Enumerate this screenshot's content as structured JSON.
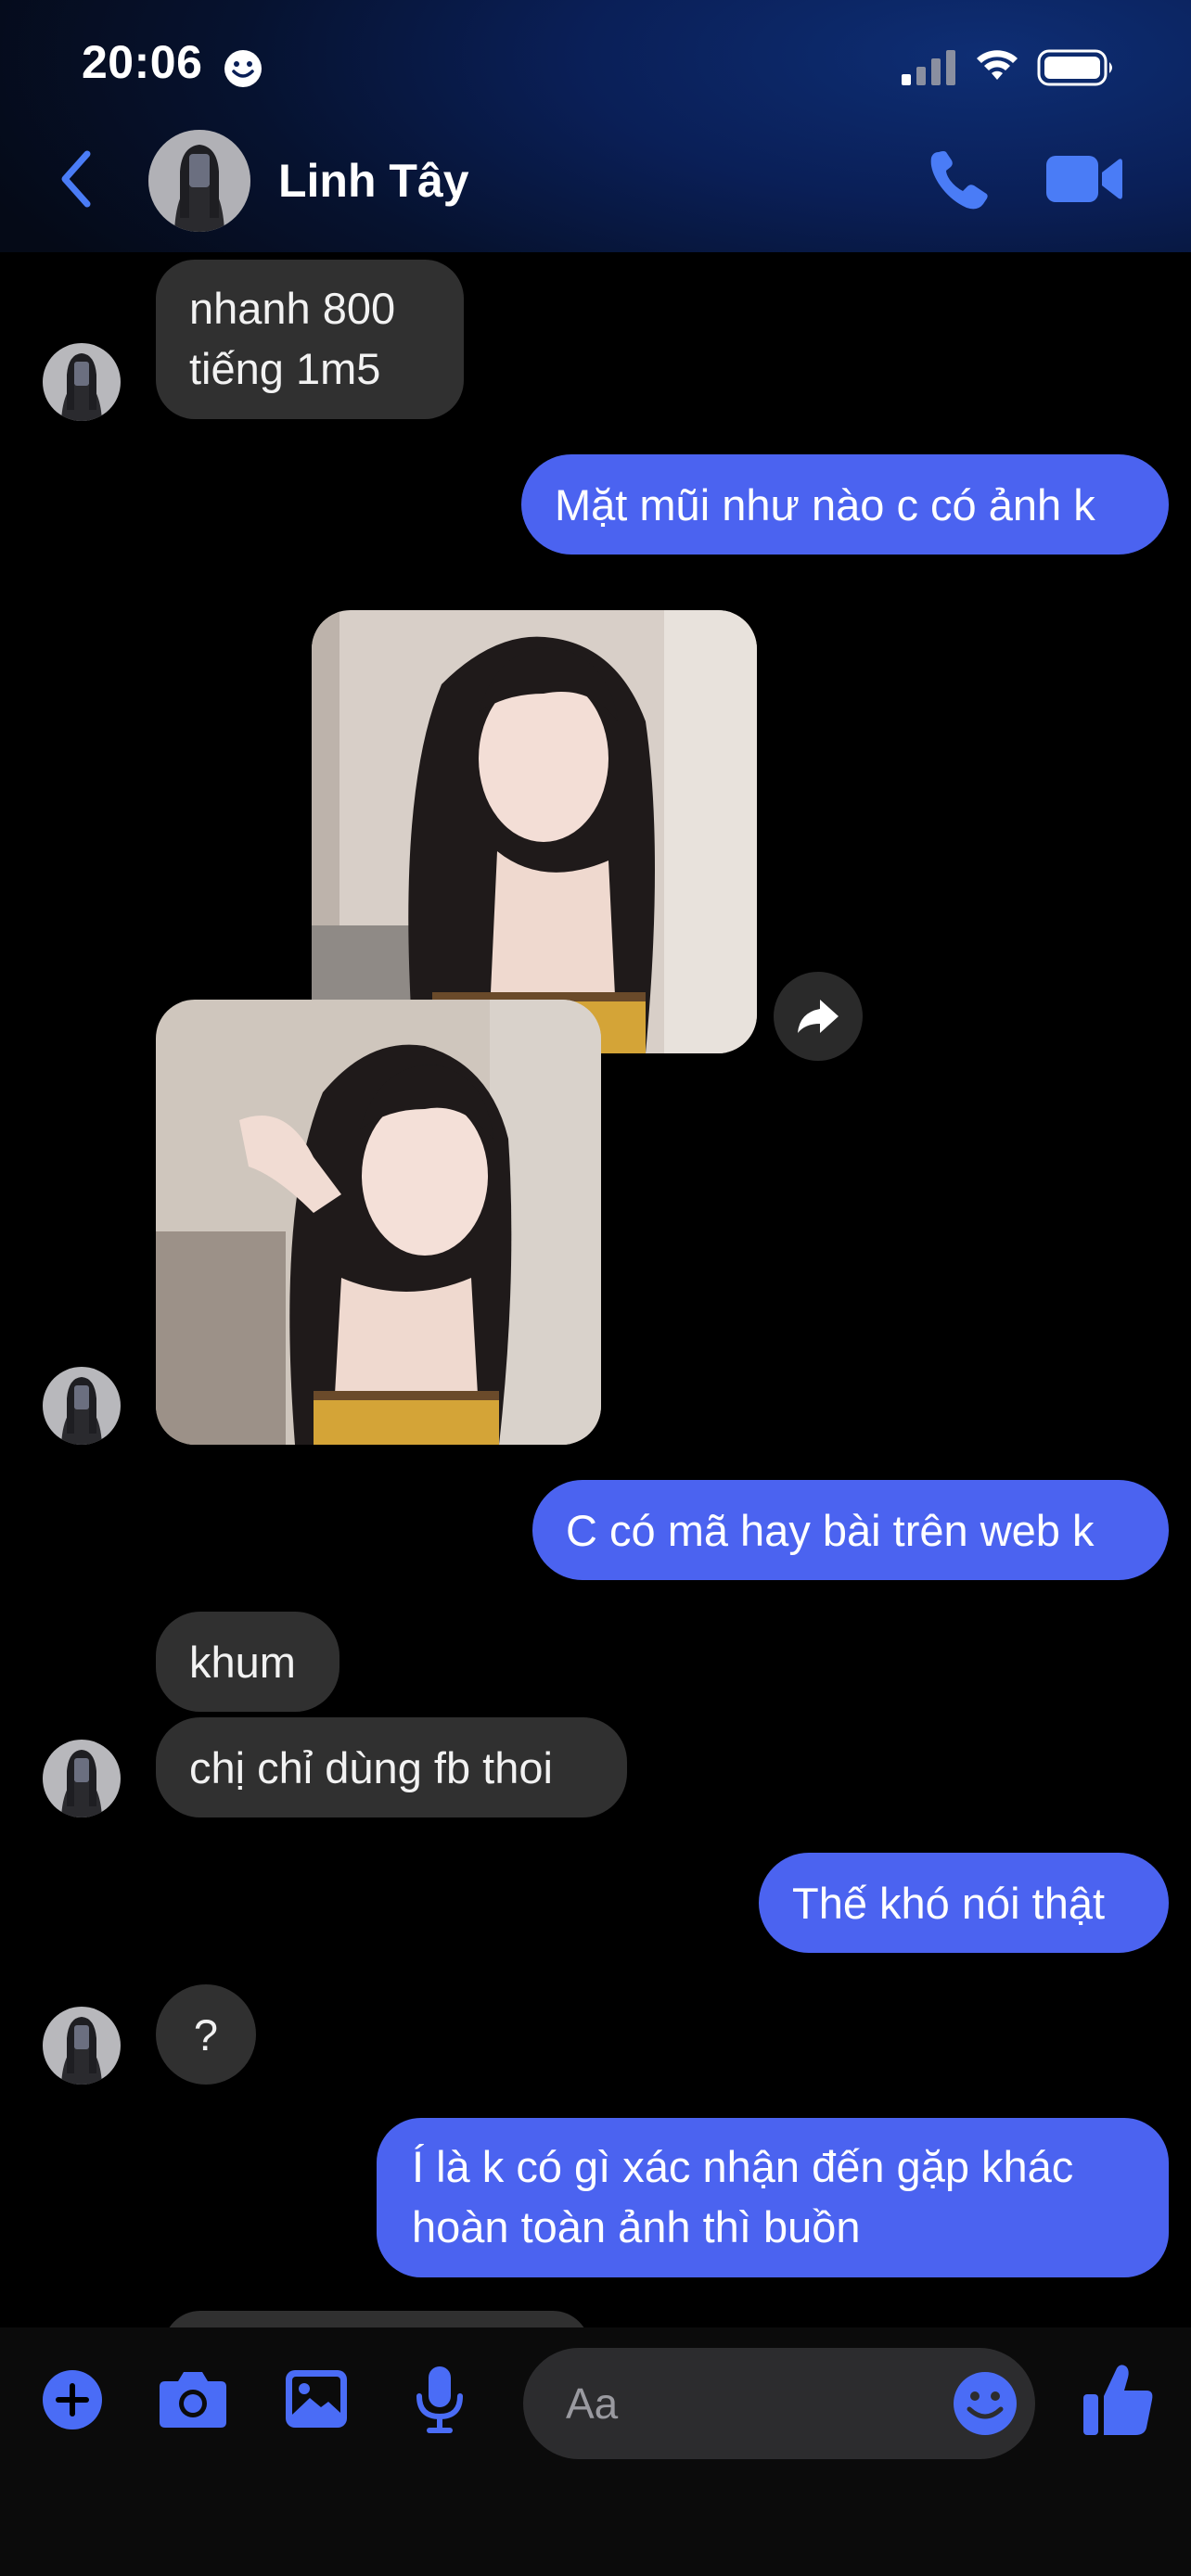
{
  "status_bar": {
    "time": "20:06"
  },
  "header": {
    "contact_name": "Linh Tây"
  },
  "messages": [
    {
      "text_lines": [
        "nhanh 800",
        "tiếng 1m5"
      ],
      "sender": "contact"
    },
    {
      "text": "Mặt mũi như nào c có ảnh k",
      "sender": "me"
    },
    {
      "text": "C có mã hay bài trên web k",
      "sender": "me"
    },
    {
      "text": "khum",
      "sender": "contact"
    },
    {
      "text": "chị chỉ dùng fb thoi",
      "sender": "contact"
    },
    {
      "text": "Thế khó nói thật",
      "sender": "me"
    },
    {
      "text": "?",
      "sender": "contact"
    },
    {
      "text_lines": [
        "Í là k có gì xác nhận đến gặp khác",
        "hoàn toàn ảnh thì buồn"
      ],
      "sender": "me"
    }
  ],
  "photos": [
    {
      "sender": "contact",
      "icon": "photo-image"
    },
    {
      "sender": "contact",
      "icon": "photo-image"
    }
  ],
  "composer": {
    "placeholder": "Aa"
  },
  "colors": {
    "accent": "#4b63f0",
    "incoming_bubble": "#303030",
    "background": "#000000"
  }
}
